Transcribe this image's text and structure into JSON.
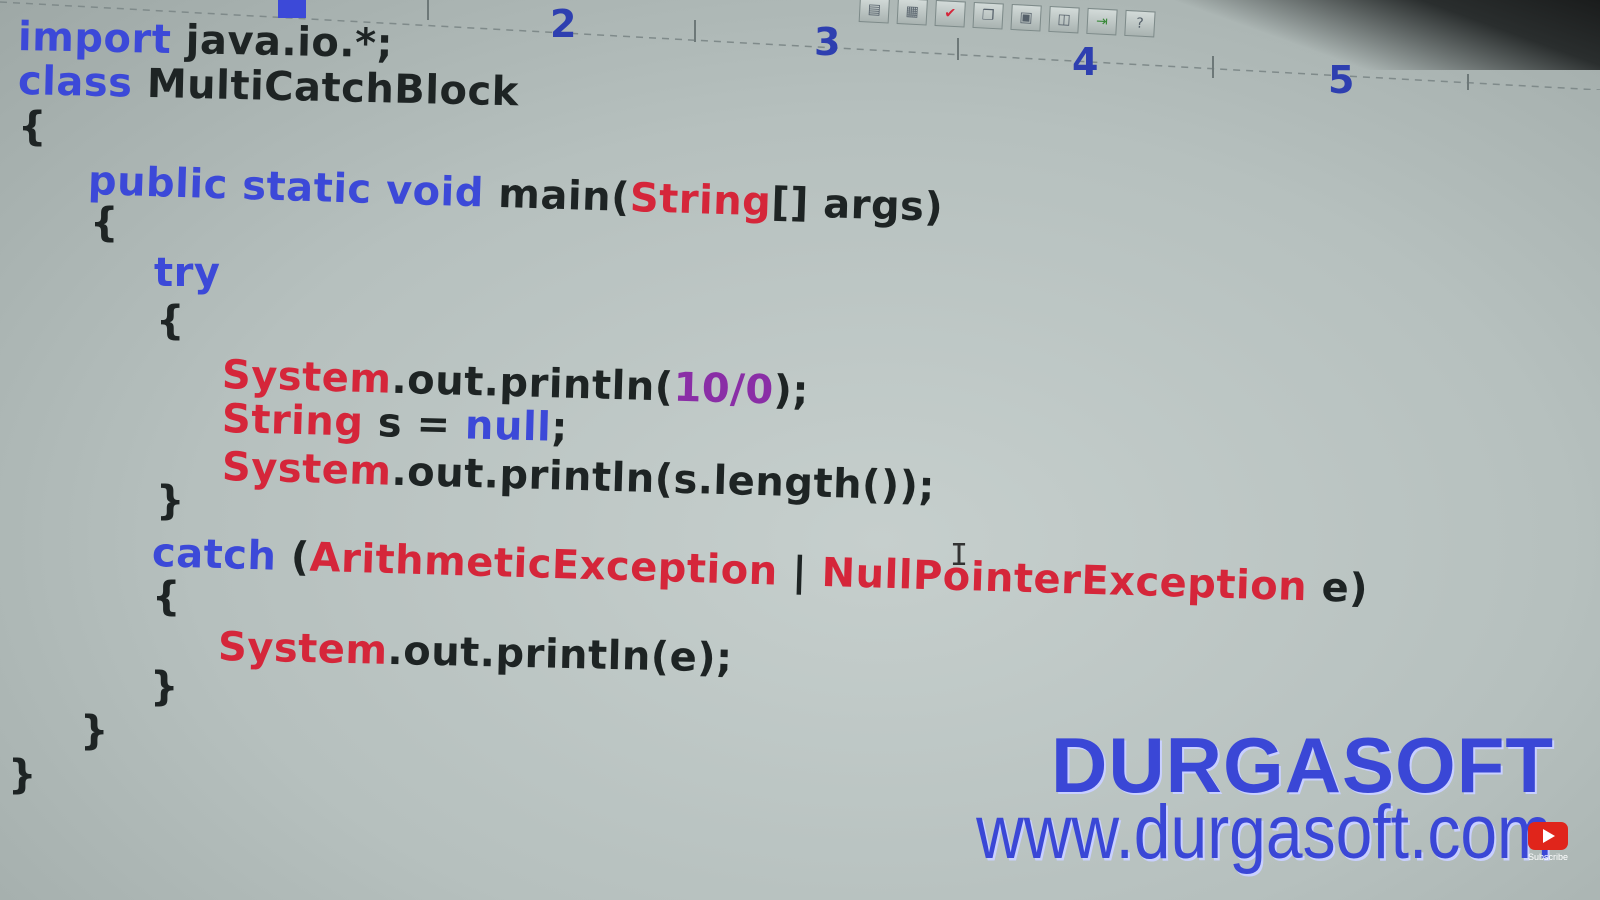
{
  "ruler": {
    "numbers": [
      "2",
      "3",
      "4",
      "5"
    ]
  },
  "toolbar": {
    "icons": [
      "chart-icon",
      "table-icon",
      "check-icon",
      "copy-icon",
      "grid-icon",
      "window-icon",
      "export-icon",
      "help-icon"
    ],
    "help_label": "?"
  },
  "code": {
    "l1": {
      "kw": "import",
      "rest": " java.io.*;"
    },
    "l2": {
      "kw": "class",
      "rest": " MultiCatchBlock"
    },
    "l3": {
      "text": "{"
    },
    "l4": {
      "kw": "public static void",
      "rest": " main(",
      "ty": "String",
      "rest2": "[] args)"
    },
    "l5": {
      "text": "{"
    },
    "l6": {
      "kw": "try"
    },
    "l7": {
      "text": "{"
    },
    "l8": {
      "ty": "System",
      "rest": ".out.println(",
      "num": "10/0",
      "rest2": ");"
    },
    "l9": {
      "ty": "String",
      "rest": " s = ",
      "kw": "null",
      "rest2": ";"
    },
    "l10": {
      "ty": "System",
      "rest": ".out.println(s.length());"
    },
    "l11": {
      "text": "}"
    },
    "l12": {
      "kw": "catch",
      "rest": " (",
      "ty": "ArithmeticException",
      "rest2": " | ",
      "ty2": "NullPointerException",
      "rest3": " e)"
    },
    "l13": {
      "text": "{"
    },
    "l14": {
      "ty": "System",
      "rest": ".out.println(e);"
    },
    "l15": {
      "text": "}"
    },
    "l16": {
      "text": "}"
    },
    "l17": {
      "text": "}"
    }
  },
  "cursor": "I",
  "watermark": {
    "title": "DURGASOFT",
    "url": "www.durgasoft.com"
  },
  "subscribe": {
    "label": "Subscribe"
  },
  "colors": {
    "keyword": "#3c49d8",
    "type": "#d5263a",
    "number": "#8a2ea6",
    "plain": "#1e2424",
    "watermark": "#3a47d6",
    "background": "#b9c3c1"
  }
}
